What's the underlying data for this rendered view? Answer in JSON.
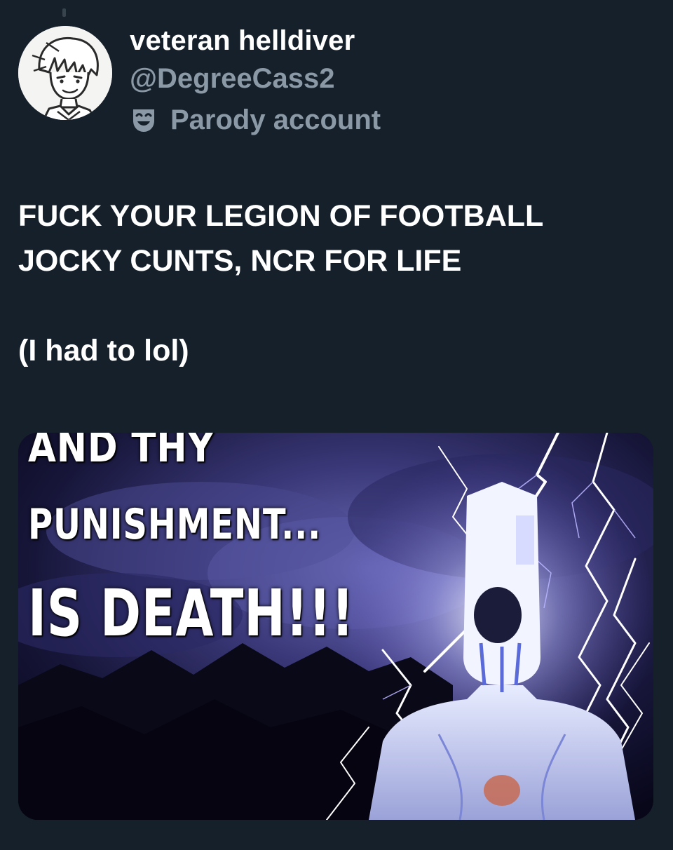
{
  "author": {
    "display_name": "veteran helldiver",
    "handle": "@DegreeCass2",
    "parody_label": "Parody account",
    "avatar_icon": "avatar-cartoon-face",
    "parody_icon": "theater-mask-icon"
  },
  "tweet": {
    "lines": [
      "FUCK YOUR LEGION OF FOOTBALL",
      "JOCKY CUNTS, NCR FOR LIFE",
      "(I had to lol)"
    ]
  },
  "media": {
    "caption_lines": [
      "AND THY",
      "PUNISHMENT...",
      "IS DEATH!!!"
    ]
  },
  "colors": {
    "background": "#15202b",
    "primary_text": "#ffffff",
    "secondary_text": "#8b98a5"
  }
}
